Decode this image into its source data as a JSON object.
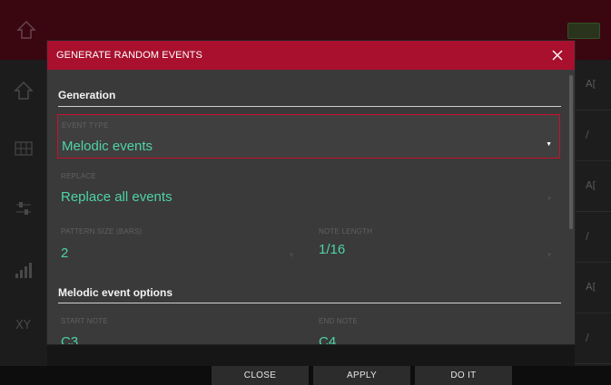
{
  "dialog": {
    "title": "GENERATE RANDOM EVENTS",
    "sections": {
      "generation": "Generation",
      "melodic_options": "Melodic event options"
    },
    "fields": {
      "event_type": {
        "label": "EVENT TYPE",
        "value": "Melodic events"
      },
      "replace": {
        "label": "REPLACE",
        "value": "Replace all events"
      },
      "pattern_size": {
        "label": "PATTERN SIZE (BARS)",
        "value": "2"
      },
      "note_length": {
        "label": "NOTE LENGTH",
        "value": "1/16"
      },
      "start_note": {
        "label": "START NOTE",
        "value": "C3"
      },
      "end_note": {
        "label": "END NOTE",
        "value": "C4"
      }
    }
  },
  "footer": {
    "close_label": "CLOSE",
    "apply_label": "APPLY",
    "doit_label": "DO IT"
  },
  "background": {
    "right_glyphs": [
      "A[",
      "/",
      "A[",
      "/",
      "A[",
      "/"
    ]
  },
  "colors": {
    "titlebar": "#a8102e",
    "accent_value": "#4fd3a4",
    "selected_border": "#c8102e",
    "dialog_bg": "#3a3a3a"
  },
  "icons": {
    "close": "close-icon",
    "dropdown": "caret-down-icon",
    "home": "home-icon"
  }
}
